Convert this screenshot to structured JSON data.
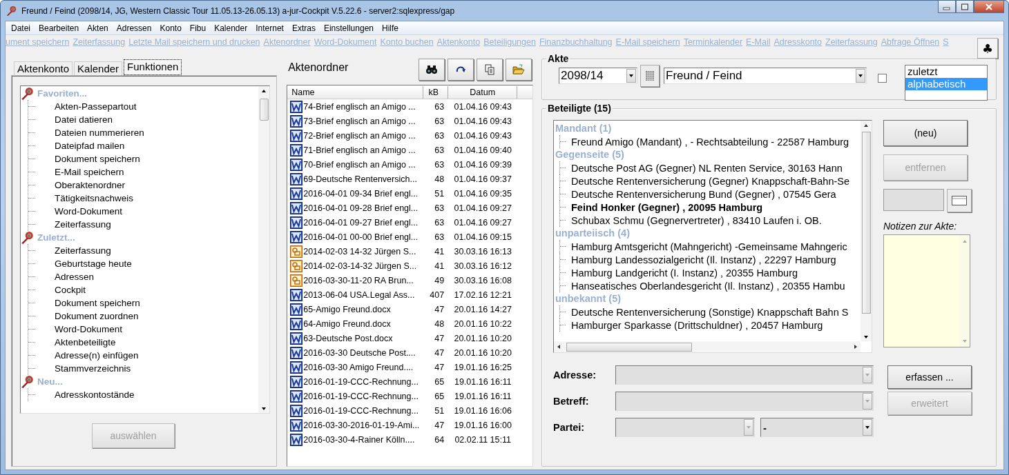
{
  "window": {
    "title": "Freund / Feind (2098/14, JG, Western Classic Tour 11.05.13-26.05.13) a-jur-Cockpit V.5.22.6 - server2:sqlexpress/gap"
  },
  "menu": [
    "Datei",
    "Bearbeiten",
    "Akten",
    "Adressen",
    "Konto",
    "Fibu",
    "Kalender",
    "Internet",
    "Extras",
    "Einstellungen",
    "Hilfe"
  ],
  "quick_links": [
    "ument speichern",
    "Zeiterfassung",
    "Letzte Mail speichern und drucken",
    "Aktenordner",
    "Word-Dokument",
    "Konto buchen",
    "Aktenkonto",
    "Beteiligungen",
    "Finanzbuchhaltung",
    "E-Mail speichern",
    "Terminkalender",
    "E-Mail",
    "Adresskonto",
    "Zeiterfassung",
    "Abfrage Öffnen",
    "S"
  ],
  "club_button": "♣",
  "tabs": [
    {
      "label": "Aktenkonto",
      "selected": false
    },
    {
      "label": "Kalender",
      "selected": false
    },
    {
      "label": "Funktionen",
      "selected": true
    }
  ],
  "functions": [
    {
      "label": "Favoriten...",
      "children": [
        "Akten-Passepartout",
        "Datei datieren",
        "Dateien nummerieren",
        "Dateipfad mailen",
        "Dokument speichern",
        "E-Mail speichern",
        "Oberaktenordner",
        "Tätigkeitsnachweis",
        "Word-Dokument",
        "Zeiterfassung"
      ]
    },
    {
      "label": "Zuletzt...",
      "children": [
        "Zeiterfassung",
        "Geburtstage heute",
        "Adressen",
        "Cockpit",
        "Dokument speichern",
        "Dokument zuordnen",
        "Word-Dokument",
        "Aktenbeteiligte",
        "Adresse(n) einfügen",
        "Stammverzeichnis"
      ]
    },
    {
      "label": "Neu...",
      "children": [
        "Adresskontostände"
      ]
    }
  ],
  "select_button": {
    "label": "auswählen",
    "disabled": true
  },
  "file_folder": {
    "title": "Aktenordner",
    "columns": [
      "Name",
      "kB",
      "Datum"
    ],
    "rows": [
      {
        "kind": "word",
        "name": "74-Brief englisch an Amigo ...",
        "kb": "63",
        "date": "01.04.16 09:43"
      },
      {
        "kind": "word",
        "name": "73-Brief englisch an Amigo ...",
        "kb": "63",
        "date": "01.04.16 09:43"
      },
      {
        "kind": "word",
        "name": "72-Brief englisch an Amigo ...",
        "kb": "63",
        "date": "01.04.16 09:43"
      },
      {
        "kind": "word",
        "name": "71-Brief englisch an Amigo ...",
        "kb": "63",
        "date": "01.04.16 09:40"
      },
      {
        "kind": "word",
        "name": "70-Brief englisch an Amigo ...",
        "kb": "63",
        "date": "01.04.16 09:39"
      },
      {
        "kind": "word",
        "name": "69-Deutsche Rentenversich...",
        "kb": "48",
        "date": "01.04.16 09:37"
      },
      {
        "kind": "word",
        "name": "2016-04-01 09-34 Brief engl...",
        "kb": "51",
        "date": "01.04.16 09:35"
      },
      {
        "kind": "word",
        "name": "2016-04-01 09-28 Brief engl...",
        "kb": "63",
        "date": "01.04.16 09:27"
      },
      {
        "kind": "word",
        "name": "2016-04-01 09-27 Brief engl...",
        "kb": "63",
        "date": "01.04.16 09:27"
      },
      {
        "kind": "word",
        "name": "2016-04-01 00-00 Brief engl...",
        "kb": "63",
        "date": "01.04.16 09:15"
      },
      {
        "kind": "image",
        "name": "2014-02-03 14-32 Jürgen S...",
        "kb": "41",
        "date": "30.03.16 16:13"
      },
      {
        "kind": "image",
        "name": "2014-02-03-14-32 Jürgen S...",
        "kb": "41",
        "date": "30.03.16 16:12"
      },
      {
        "kind": "image",
        "name": "2016-03-30-11-20 RA Brun...",
        "kb": "49",
        "date": "30.03.16 16:08"
      },
      {
        "kind": "word",
        "name": "2013-06-04 USA.Legal Ass...",
        "kb": "407",
        "date": "17.02.16 12:21"
      },
      {
        "kind": "word",
        "name": "65-Amigo Freund.docx",
        "kb": "47",
        "date": "20.01.16 14:27"
      },
      {
        "kind": "word",
        "name": "64-Amigo Freund.docx",
        "kb": "48",
        "date": "20.01.16 10:22"
      },
      {
        "kind": "word",
        "name": "63-Deutsche Post.docx",
        "kb": "47",
        "date": "20.01.16 10:20"
      },
      {
        "kind": "word",
        "name": "2016-03-30 Deutsche Post....",
        "kb": "47",
        "date": "20.01.16 10:20"
      },
      {
        "kind": "word",
        "name": "2016-03-30 Amigo Freund....",
        "kb": "47",
        "date": "19.01.16 16:25"
      },
      {
        "kind": "word",
        "name": "2016-01-19-CCC-Rechnung...",
        "kb": "65",
        "date": "19.01.16 16:11"
      },
      {
        "kind": "word",
        "name": "2016-01-19-CCC-Rechnung...",
        "kb": "65",
        "date": "19.01.16 16:11"
      },
      {
        "kind": "word",
        "name": "2016-01-19-CCC-Rechnung...",
        "kb": "51",
        "date": "19.01.16 16:06"
      },
      {
        "kind": "word",
        "name": "2016-03-30-2016-01-19-Ami...",
        "kb": "47",
        "date": "19.01.16 16:00"
      },
      {
        "kind": "word",
        "name": "2016-03-30-4-Rainer Kölln....",
        "kb": "64",
        "date": "02.02.11 15:11"
      }
    ]
  },
  "akte": {
    "title": "Akte",
    "number": "2098/14",
    "name": "Freund / Feind",
    "checked": false,
    "sort_options": [
      {
        "label": "zuletzt",
        "selected": false
      },
      {
        "label": "alphabetisch",
        "selected": true
      }
    ]
  },
  "beteiligte": {
    "title": "Beteiligte (15)",
    "groups": [
      {
        "label": "Mandant (1)",
        "children": [
          {
            "text": "Freund Amigo (Mandant) , - Rechtsabteilung - 22587 Hamburg",
            "bold": false
          }
        ]
      },
      {
        "label": "Gegenseite (5)",
        "children": [
          {
            "text": "Deutsche Post AG  (Gegner) NL Renten Service,  30163 Hann",
            "bold": false
          },
          {
            "text": "Deutsche Rentenversicherung  (Gegner) Knappschaft-Bahn-Se",
            "bold": false
          },
          {
            "text": "Deutsche Rentenversicherung Bund  (Gegner) ,  07545 Gera",
            "bold": false
          },
          {
            "text": "Feind Honker (Gegner) ,  20095 Hamburg",
            "bold": true
          },
          {
            "text": "Schubax Schmu (Gegnervertreter) ,  83410 Laufen i. OB.",
            "bold": false
          }
        ]
      },
      {
        "label": "unparteiisch (4)",
        "children": [
          {
            "text": "Hamburg Amtsgericht (Mahngericht) -Gemeinsame Mahngeric",
            "bold": false
          },
          {
            "text": "Hamburg Landessozialgericht (Il. Instanz) ,  22297 Hamburg",
            "bold": false
          },
          {
            "text": "Hamburg Landgericht (I. Instanz) ,  20355 Hamburg",
            "bold": false
          },
          {
            "text": "Hanseatisches Oberlandesgericht  (Il. Instanz) ,  20355 Hambu",
            "bold": false
          }
        ]
      },
      {
        "label": "unbekannt (5)",
        "children": [
          {
            "text": "Deutsche Rentenversicherung  (Sonstige) Knappschaft Bahn S",
            "bold": false
          },
          {
            "text": "Hamburger Sparkasse  (Drittschuldner) ,  20457 Hamburg",
            "bold": false
          }
        ]
      }
    ],
    "buttons": [
      {
        "label": "(neu)",
        "disabled": false
      },
      {
        "label": "entfernen",
        "disabled": true
      }
    ],
    "notes_label": "Notizen zur Akte:",
    "fields": [
      {
        "label": "Adresse:",
        "disabled": true
      },
      {
        "label": "Betreff:",
        "disabled": true
      }
    ],
    "party": {
      "label": "Partei:",
      "first_disabled": true,
      "value": "-"
    },
    "form_buttons": [
      {
        "label": "erfassen ...",
        "disabled": false
      },
      {
        "label": "erweitert",
        "disabled": true
      }
    ]
  }
}
